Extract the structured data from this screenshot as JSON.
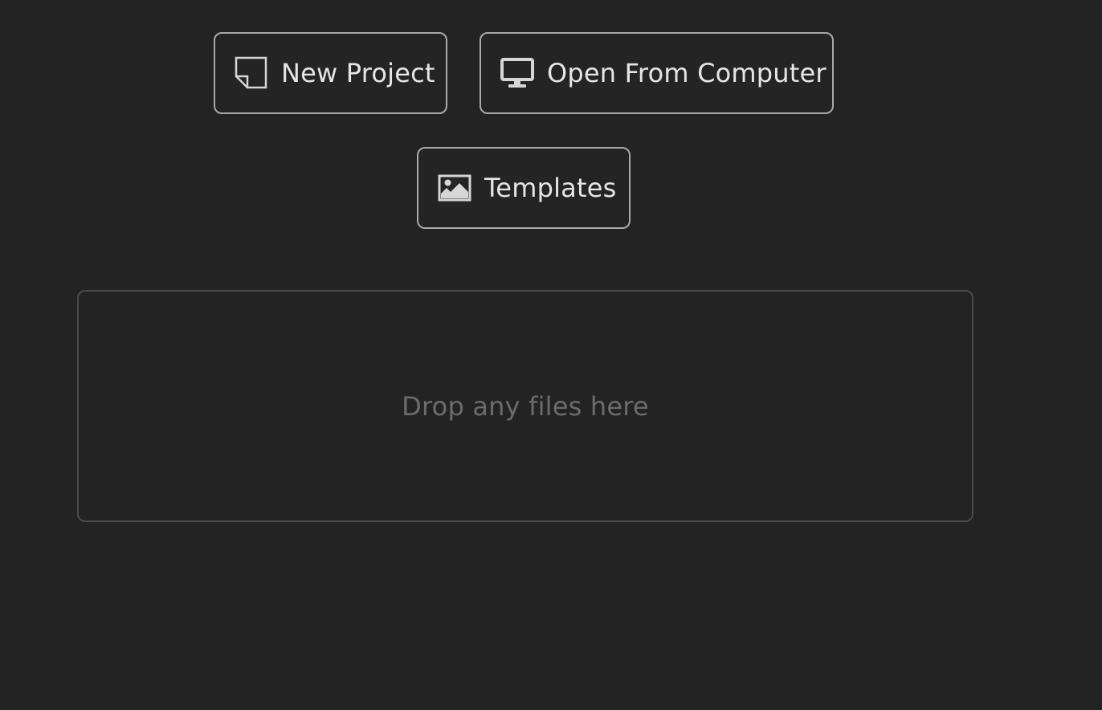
{
  "actions": {
    "new_project": {
      "label": "New Project",
      "icon": "new-document-icon"
    },
    "open_from_computer": {
      "label": "Open From Computer",
      "icon": "monitor-icon"
    },
    "templates": {
      "label": "Templates",
      "icon": "image-icon"
    }
  },
  "dropzone": {
    "text": "Drop any files here"
  },
  "colors": {
    "background": "#232323",
    "button_border": "#a9a9a9",
    "button_text": "#e6e6e6",
    "dropzone_border": "#4a4a4a",
    "dropzone_text": "#6c6c6c"
  }
}
